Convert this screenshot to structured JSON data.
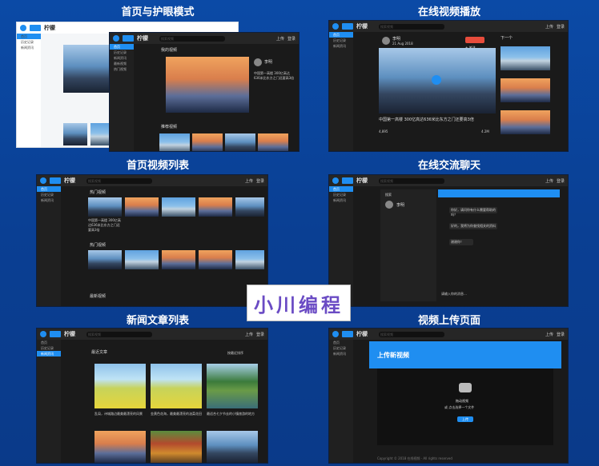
{
  "sections": {
    "home_eye": "首页与护眼模式",
    "video_play": "在线视频播放",
    "home_video_list": "首页视频列表",
    "chat": "在线交流聊天",
    "news": "新闻文章列表",
    "upload": "视频上传页面"
  },
  "brand": "柠檬",
  "watermark": "小川编程",
  "topbar": {
    "search_placeholder": "搜索视频",
    "upload": "上传",
    "login": "登录"
  },
  "sidebar": {
    "home": "首页",
    "history": "历史记录",
    "news": "新闻资讯",
    "hot": "最新视频",
    "popular": "热门视频"
  },
  "home": {
    "section_label": "我的视频",
    "video_title": "中国第一高楼 300亿高达636米比东方之门还要高3倍",
    "author": "李明",
    "subscribe": "订阅",
    "recommend_label": "推荐视频"
  },
  "player": {
    "author": "李明",
    "date": "21 Aug 2018",
    "follow": "+ 关注",
    "next_label": "下一个",
    "title": "中国第一高楼 300亿高达636米比东方之门还要高3倍",
    "views": "4,895",
    "likes": "4.2M"
  },
  "list": {
    "section1": "热门视频",
    "section2": "热门视频",
    "section3": "最新视频",
    "item_title": "中国第一高楼 300亿高达636米比东方之门还要高3倍"
  },
  "chat": {
    "search": "搜索",
    "user": "李明",
    "input_placeholder": "请输入你的消息…",
    "messages": [
      "你好，请问你有什么需要帮助的吗？",
      "好的，我将为你查找相关的资料",
      "谢谢你！"
    ]
  },
  "news": {
    "header": "最近文章",
    "filter": "按最近排序",
    "articles": [
      {
        "title": "乱局，诗城路边最美最漂亮的风景"
      },
      {
        "title": "金黄色花海，最美最漂亮的油菜花田"
      },
      {
        "title": "最适合七夕节去的小镇旅游的地方"
      }
    ]
  },
  "upload": {
    "title": "上传新视频",
    "hint": "拖动视频",
    "subhint": "或 点击选择一个文件",
    "button": "上传",
    "footer": "Copyright © 2018 在线视频 · All rights reserved"
  }
}
